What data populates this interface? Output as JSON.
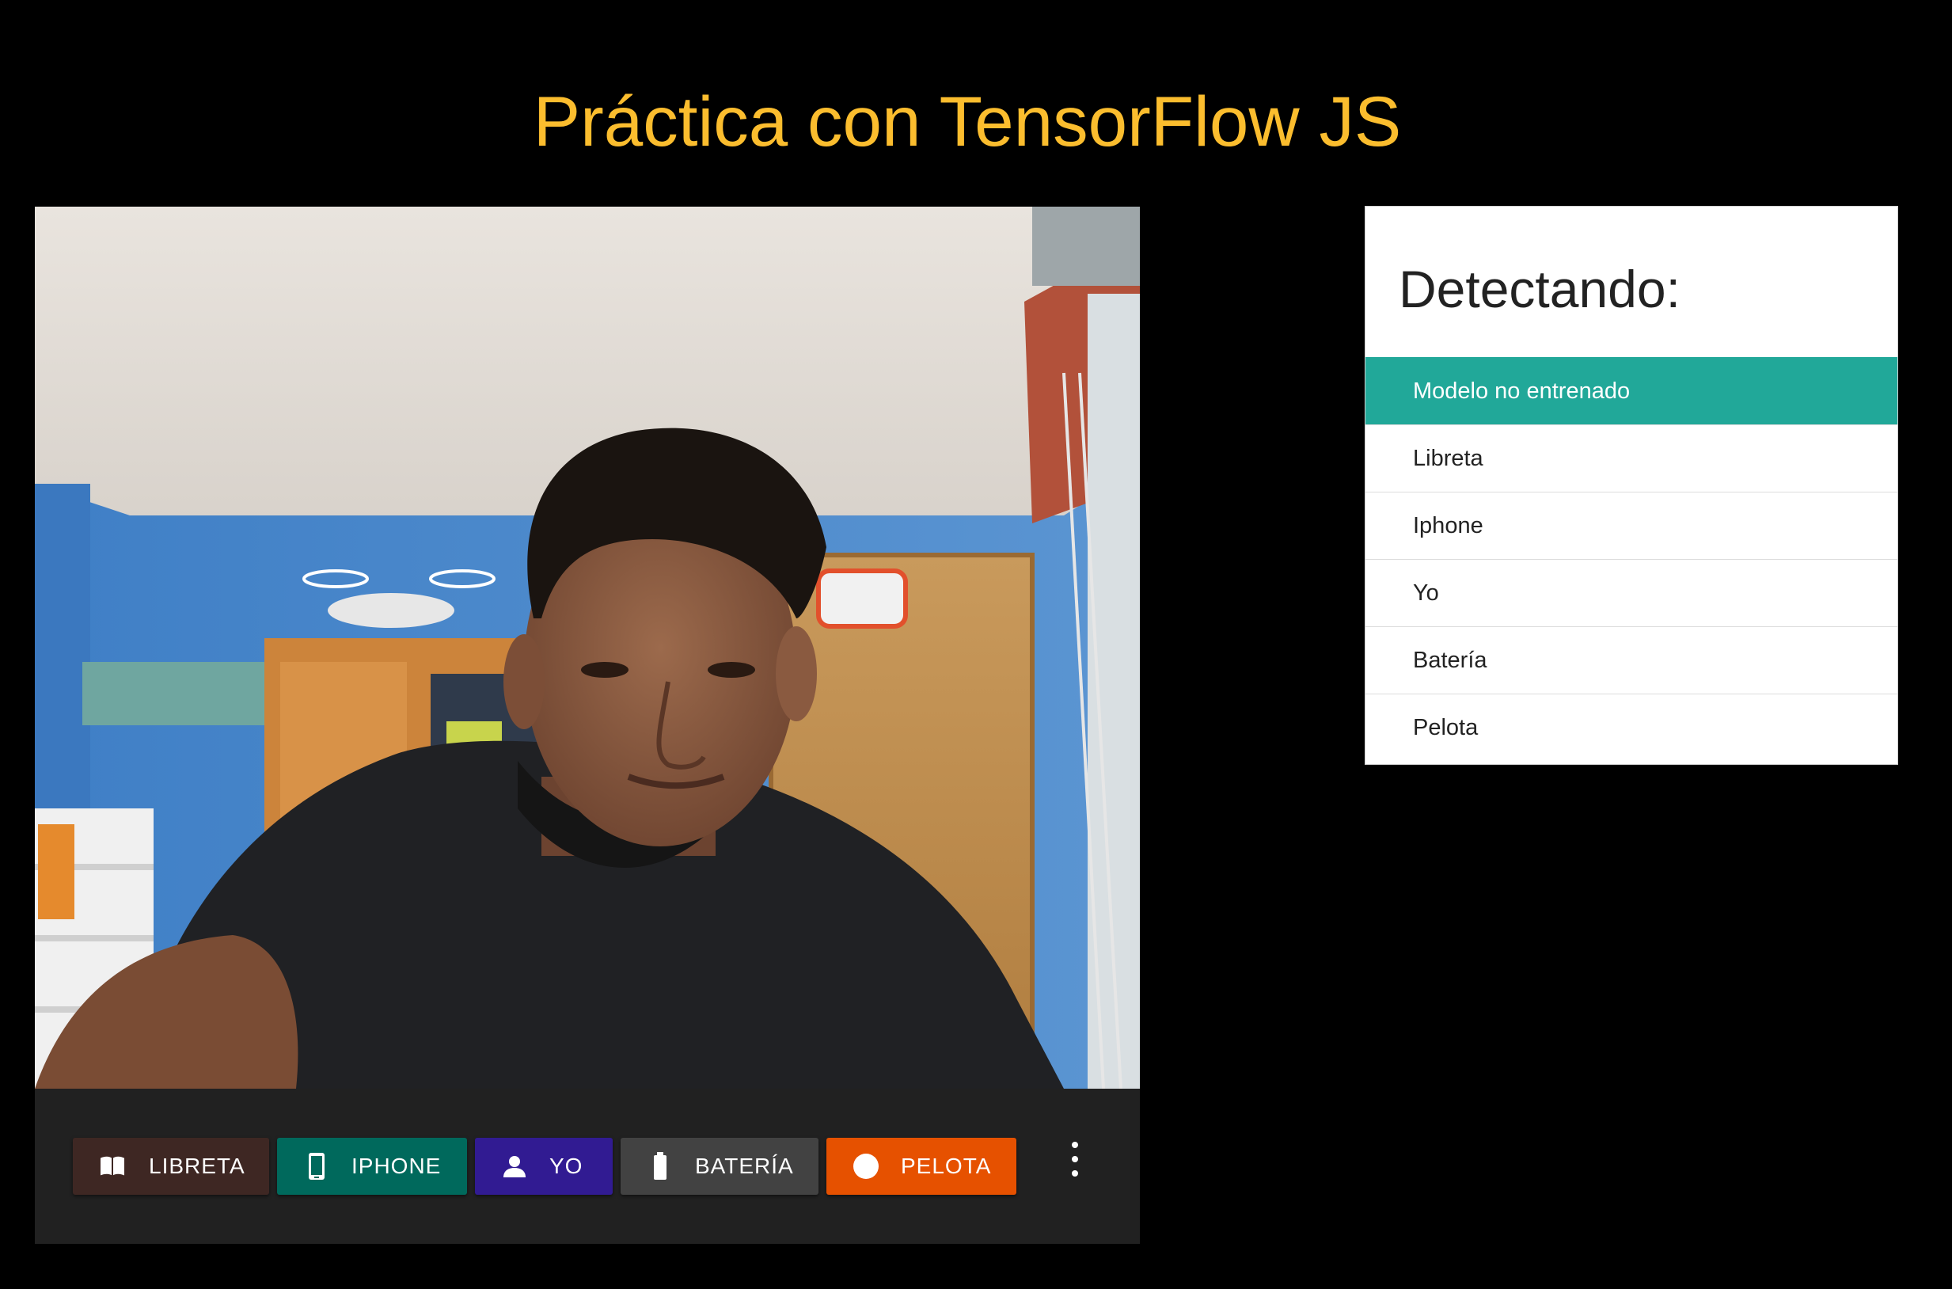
{
  "header": {
    "title": "Práctica con TensorFlow JS"
  },
  "classes": [
    {
      "label": "LIBRETA",
      "icon": "book-icon",
      "color": "#3e2723"
    },
    {
      "label": "IPHONE",
      "icon": "phone-icon",
      "color": "#00695c"
    },
    {
      "label": "YO",
      "icon": "person-icon",
      "color": "#311b92"
    },
    {
      "label": "BATERÍA",
      "icon": "battery-icon",
      "color": "#424242"
    },
    {
      "label": "PELOTA",
      "icon": "circle-icon",
      "color": "#e65100"
    }
  ],
  "menu": {
    "icon": "more-vert-icon"
  },
  "detection": {
    "title": "Detectando:",
    "accent": "#21a899",
    "items": [
      {
        "label": "Modelo no entrenado",
        "active": true
      },
      {
        "label": "Libreta"
      },
      {
        "label": "Iphone"
      },
      {
        "label": "Yo"
      },
      {
        "label": "Batería"
      },
      {
        "label": "Pelota"
      }
    ]
  }
}
